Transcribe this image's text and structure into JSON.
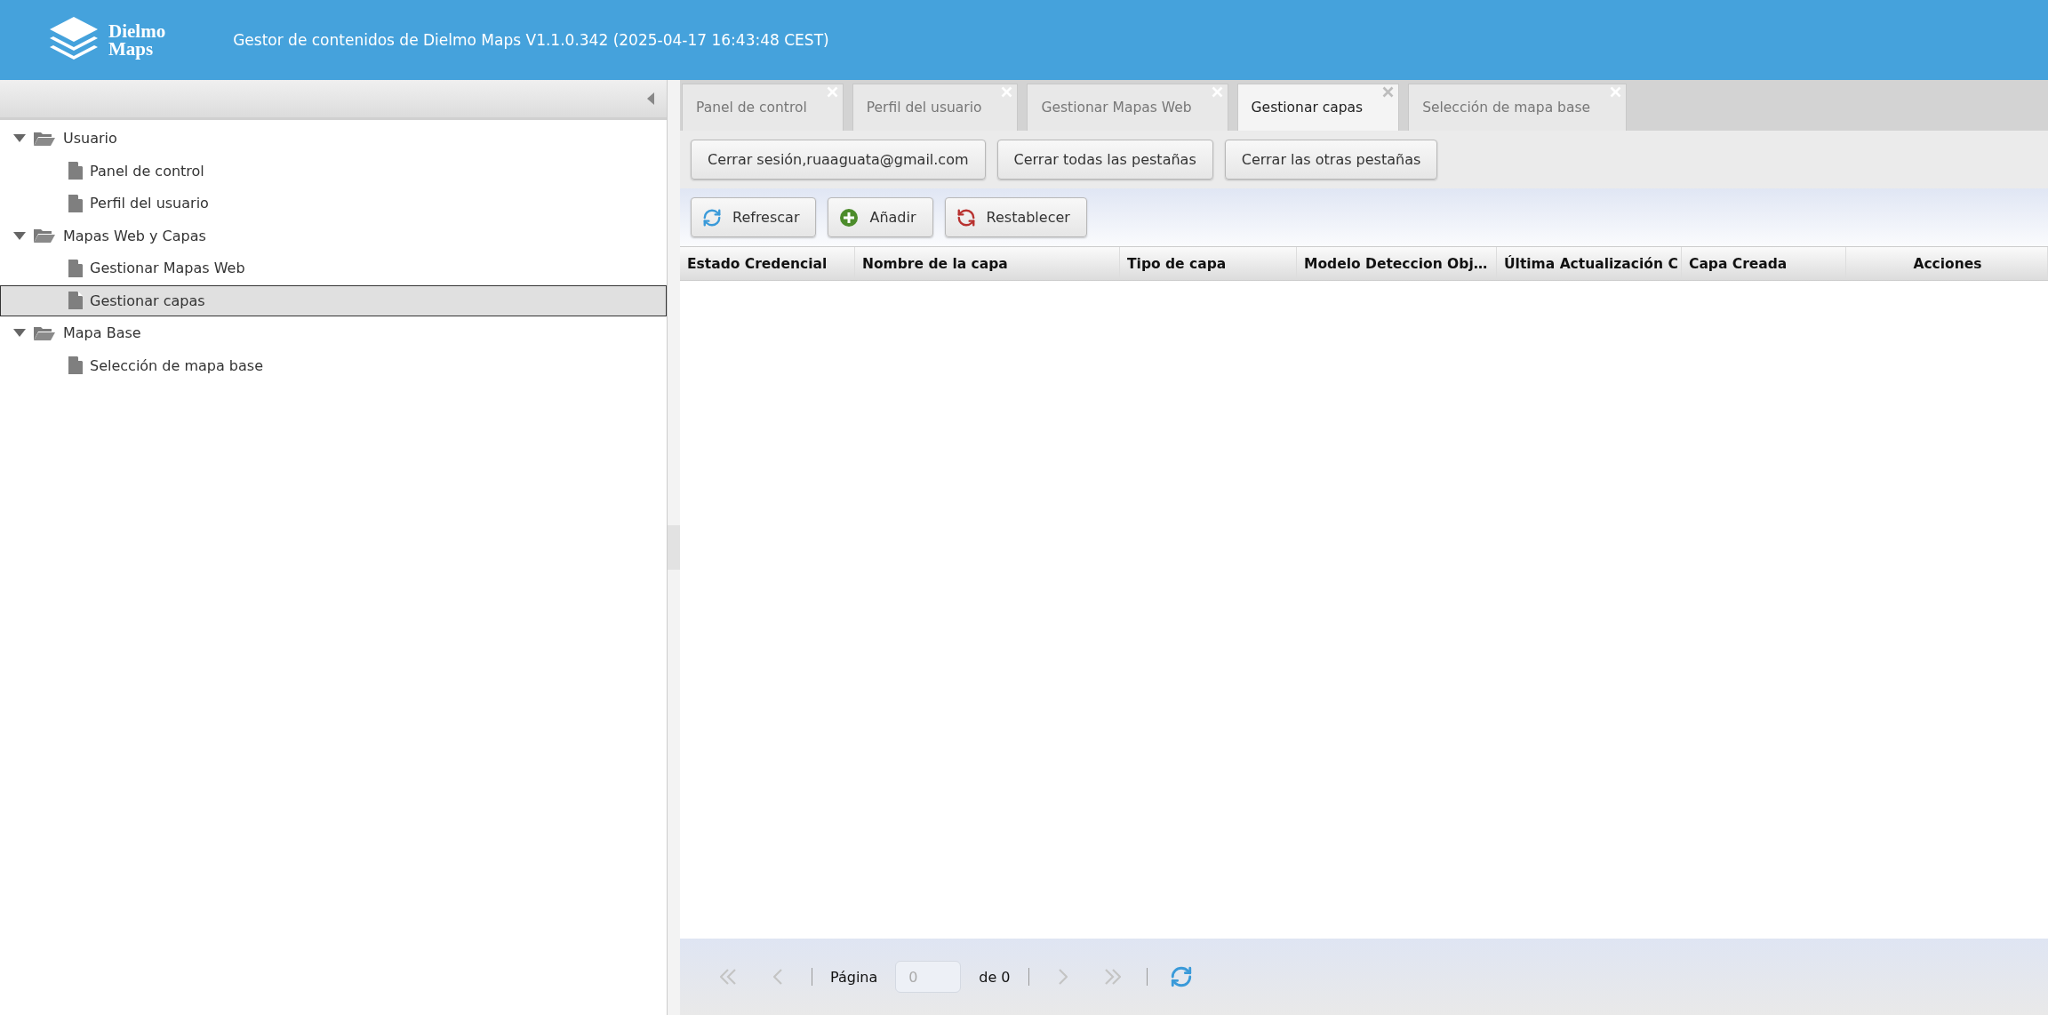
{
  "header": {
    "logo_lines": [
      "Dielmo",
      "Maps"
    ],
    "title": "Gestor de contenidos de Dielmo Maps V1.1.0.342 (2025-04-17 16:43:48 CEST)"
  },
  "sidebar": {
    "tree": [
      {
        "label": "Usuario",
        "expanded": true,
        "selected": false,
        "children": [
          {
            "label": "Panel de control",
            "selected": false
          },
          {
            "label": "Perfil del usuario",
            "selected": false
          }
        ]
      },
      {
        "label": "Mapas Web y Capas",
        "expanded": true,
        "selected": false,
        "children": [
          {
            "label": "Gestionar Mapas Web",
            "selected": false
          },
          {
            "label": "Gestionar capas",
            "selected": true
          }
        ]
      },
      {
        "label": "Mapa Base",
        "expanded": true,
        "selected": false,
        "children": [
          {
            "label": "Selección de mapa base",
            "selected": false
          }
        ]
      }
    ]
  },
  "tabs": [
    {
      "label": "Panel de control",
      "selected": false
    },
    {
      "label": "Perfil del usuario",
      "selected": false
    },
    {
      "label": "Gestionar Mapas Web",
      "selected": false
    },
    {
      "label": "Gestionar capas",
      "selected": true
    },
    {
      "label": "Selección de mapa base",
      "selected": false
    }
  ],
  "session_buttons": [
    "Cerrar sesión,ruaaguata@gmail.com",
    "Cerrar todas las pestañas",
    "Cerrar las otras pestañas"
  ],
  "toolbar": [
    {
      "label": "Refrescar",
      "kind": "refresh"
    },
    {
      "label": "Añadir",
      "kind": "add"
    },
    {
      "label": "Restablecer",
      "kind": "reset"
    }
  ],
  "table": {
    "columns": [
      {
        "label": "Estado Credencial"
      },
      {
        "label": "Nombre de la capa"
      },
      {
        "label": "Tipo de capa"
      },
      {
        "label": "Modelo Deteccion Obj…"
      },
      {
        "label": "Última Actualización C"
      },
      {
        "label": "Capa Creada"
      },
      {
        "label": "Acciones"
      }
    ]
  },
  "pagination": {
    "nav_before": [
      {
        "kind": "first",
        "disabled": true
      },
      {
        "kind": "prev",
        "disabled": true
      }
    ],
    "page_label": "Página",
    "page_value": "0",
    "of_text": "de 0",
    "nav_after": [
      {
        "kind": "next",
        "disabled": true
      },
      {
        "kind": "last",
        "disabled": true
      }
    ]
  }
}
